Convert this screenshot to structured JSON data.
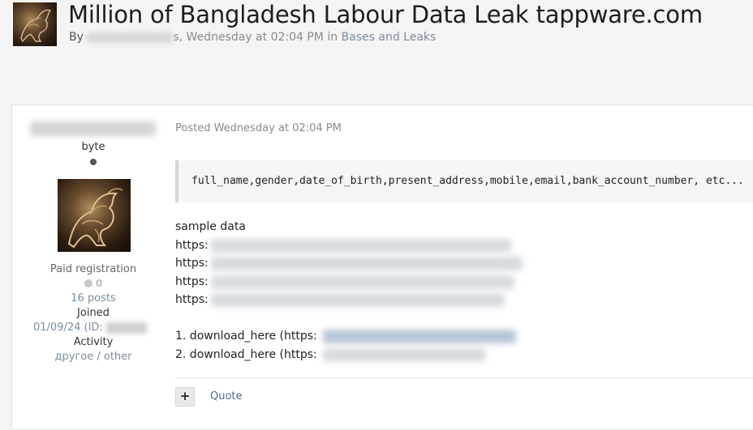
{
  "topic": {
    "title": "Million of Bangladesh Labour Data Leak tappware.com",
    "by_label": "By",
    "author_tail": "s",
    "meta": ", Wednesday at 02:04 PM in",
    "forum": "Bases and Leaks"
  },
  "post": {
    "author": {
      "rank": "byte",
      "group": "Paid registration",
      "reputation": "0",
      "posts": "16 posts",
      "joined_label": "Joined",
      "joined_value": "01/09/24 (ID: ",
      "activity_label": "Activity",
      "activity_value": "другое / other"
    },
    "posted": "Posted Wednesday at 02:04 PM",
    "code": "full_name,gender,date_of_birth,present_address,mobile,email,bank_account_number, etc...",
    "sample_label": "sample data",
    "link_prefix": "https:",
    "download_1": "1. download_here (https:",
    "download_2": "2. download_here (https:",
    "quote_label": "Quote",
    "plus_label": "+"
  }
}
